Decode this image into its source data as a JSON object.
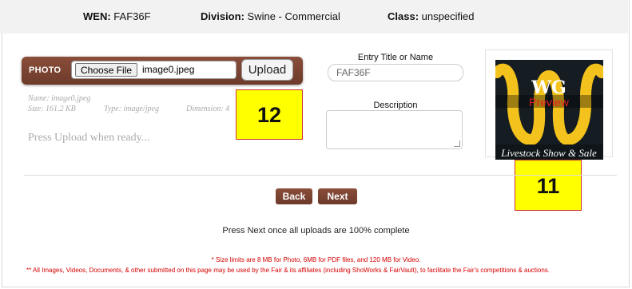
{
  "header": {
    "wen_label": "WEN:",
    "wen_value": "FAF36F",
    "division_label": "Division:",
    "division_value": "Swine - Commercial",
    "class_label": "Class:",
    "class_value": "unspecified"
  },
  "photo": {
    "label": "PHOTO",
    "choose_label": "Choose File",
    "file_name": "image0.jpeg",
    "upload_label": "Upload",
    "meta_name": "Name: image0.jpeg",
    "meta_size": "Size: 161.2 KB",
    "meta_type": "Type: image/jpeg",
    "meta_dimension": "Dimension: 4",
    "ready_text": "Press Upload when ready..."
  },
  "entry": {
    "title_label": "Entry Title or Name",
    "title_value": "FAF36F",
    "description_label": "Description",
    "description_value": ""
  },
  "preview": {
    "logo_text": "WG",
    "overlay_text": "Preview",
    "tagline": "Livestock Show & Sale"
  },
  "badges": {
    "badge_12": "12",
    "badge_11": "11"
  },
  "nav": {
    "back_label": "Back",
    "next_label": "Next",
    "note": "Press Next once all uploads are 100% complete"
  },
  "footer": {
    "limits": "* Size limits are 8 MB for Photo, 6MB for PDF files, and 120 MB for Video.",
    "usage": "** All Images, Videos, Documents, & other submitted on this page may be used by the Fair & its affiliates (including ShoWorks & FairVault), to facilitate the Fair's competitions & auctions."
  },
  "colors": {
    "brand_brown": "#7a4332",
    "badge_yellow": "#ffff00",
    "warning_red": "#d40000"
  }
}
